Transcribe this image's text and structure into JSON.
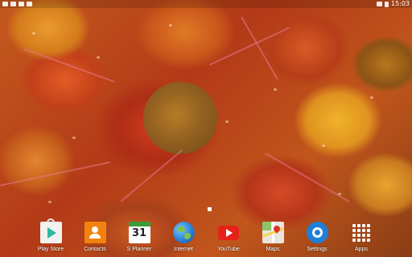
{
  "status_bar": {
    "clock": "15:03",
    "left_icons": [
      "gallery-notification-icon",
      "screenshot-notification-icon",
      "android-notification-icon",
      "download-notification-icon"
    ],
    "right_icons": [
      "wifi-icon",
      "battery-icon"
    ]
  },
  "home": {
    "current_page": 1
  },
  "dock": {
    "apps": [
      {
        "label": "Play Store",
        "icon": "play-store-icon"
      },
      {
        "label": "Contacts",
        "icon": "contacts-icon"
      },
      {
        "label": "S Planner",
        "icon": "calendar-icon",
        "day": "31"
      },
      {
        "label": "Internet",
        "icon": "globe-icon"
      },
      {
        "label": "YouTube",
        "icon": "youtube-icon"
      },
      {
        "label": "Maps",
        "icon": "maps-icon"
      },
      {
        "label": "Settings",
        "icon": "settings-gear-icon"
      },
      {
        "label": "Apps",
        "icon": "app-grid-icon"
      }
    ]
  },
  "colors": {
    "wallpaper_primary": "#b8431c",
    "youtube_red": "#e62117",
    "contacts_orange": "#f2820f",
    "calendar_green": "#3a9d3a",
    "settings_blue": "#1f7fd8"
  }
}
